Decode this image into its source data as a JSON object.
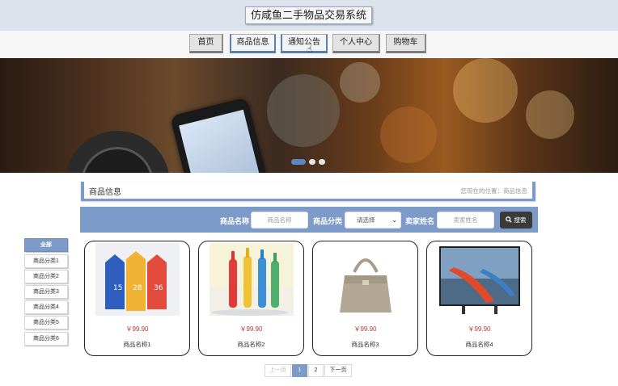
{
  "header": {
    "title": "仿咸鱼二手物品交易系统"
  },
  "nav": [
    {
      "label": "首页"
    },
    {
      "label": "商品信息"
    },
    {
      "label": "通知公告"
    },
    {
      "label": "个人中心"
    },
    {
      "label": "购物车"
    }
  ],
  "banner": {
    "slides": 3,
    "active_slide": 1
  },
  "info": {
    "title": "商品信息",
    "location": "您现在的位置：商品信息"
  },
  "search": {
    "name_label": "商品名称",
    "name_placeholder": "商品名称",
    "category_label": "商品分类",
    "category_selected": "请选择",
    "seller_label": "卖家姓名",
    "seller_placeholder": "卖家姓名",
    "button_label": "搜索",
    "button_icon": "search-icon"
  },
  "sidebar": [
    {
      "label": "全部"
    },
    {
      "label": "商品分类1"
    },
    {
      "label": "商品分类2"
    },
    {
      "label": "商品分类3"
    },
    {
      "label": "商品分类4"
    },
    {
      "label": "商品分类5"
    },
    {
      "label": "商品分类6"
    }
  ],
  "products": [
    {
      "price": "￥99.90",
      "name": "商品名称1",
      "image": "colorful milk cartons"
    },
    {
      "price": "￥99.90",
      "name": "商品名称2",
      "image": "painted bottles"
    },
    {
      "price": "￥99.90",
      "name": "商品名称3",
      "image": "handbag"
    },
    {
      "price": "￥99.90",
      "name": "商品名称4",
      "image": "kayaks on television"
    }
  ],
  "pagination": {
    "prev": "上一页",
    "pages": [
      "1",
      "2"
    ],
    "current": "1",
    "next": "下一页"
  },
  "colors": {
    "accent": "#7c9bc8",
    "price": "#c0392b",
    "header_bg": "#dde3ec"
  }
}
